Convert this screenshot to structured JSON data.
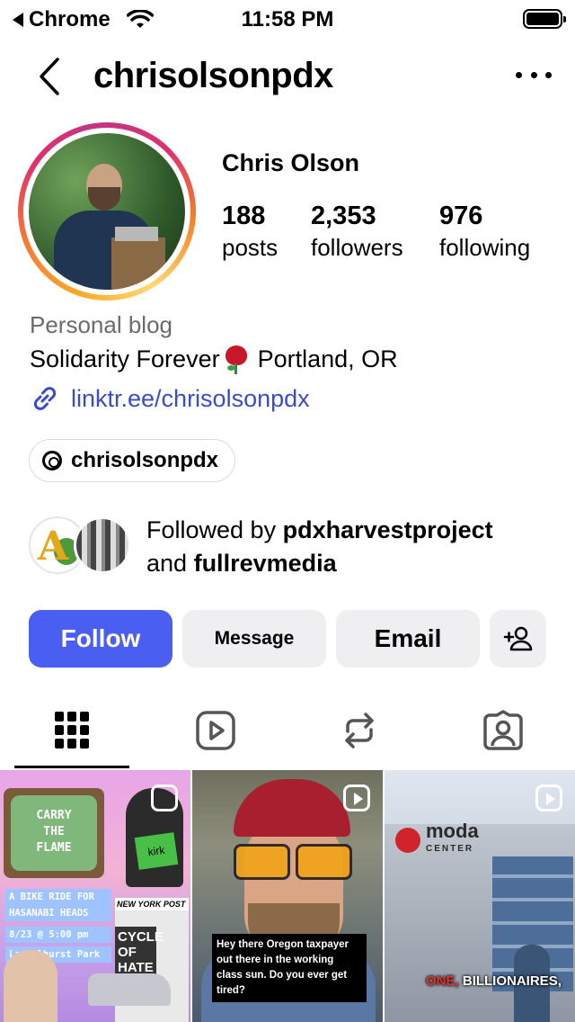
{
  "status_bar": {
    "back_app": "Chrome",
    "time": "11:58 PM"
  },
  "nav": {
    "username": "chrisolsonpdx"
  },
  "profile": {
    "full_name": "Chris Olson",
    "stats": [
      {
        "value": "188",
        "label": "posts"
      },
      {
        "value": "2,353",
        "label": "followers"
      },
      {
        "value": "976",
        "label": "following"
      }
    ],
    "category": "Personal blog",
    "bio_part1": "Solidarity Forever",
    "bio_part2": "Portland, OR",
    "link": "linktr.ee/chrisolsonpdx",
    "threads_handle": "chrisolsonpdx"
  },
  "followed_by": {
    "prefix": "Followed by",
    "user1": "pdxharvestproject",
    "joiner": "and",
    "user2": "fullrevmedia"
  },
  "actions": {
    "follow": "Follow",
    "message": "Message",
    "email": "Email"
  },
  "colors": {
    "accent": "#4a5ef2",
    "link": "#3a4bd1"
  },
  "posts": [
    {
      "tv_line1": "CARRY",
      "tv_line2": "THE",
      "tv_line3": "FLAME",
      "line1": "A BIKE RIDE FOR",
      "line2": "HASANABI HEADS",
      "line3": "8/23 @ 5:00 pm",
      "line4": "Laurelhurst Park",
      "tag": "kirk",
      "paper_header": "NEW YORK POST",
      "paper_headline": "CYCLE OF HATE"
    },
    {
      "caption": "Hey there Oregon taxpayer out there in the working class sun. Do you ever get tired?"
    },
    {
      "logo_line1": "moda",
      "logo_line2": "CENTER",
      "caption_red": "ONE,",
      "caption_white": "BILLIONAIRES,"
    }
  ]
}
